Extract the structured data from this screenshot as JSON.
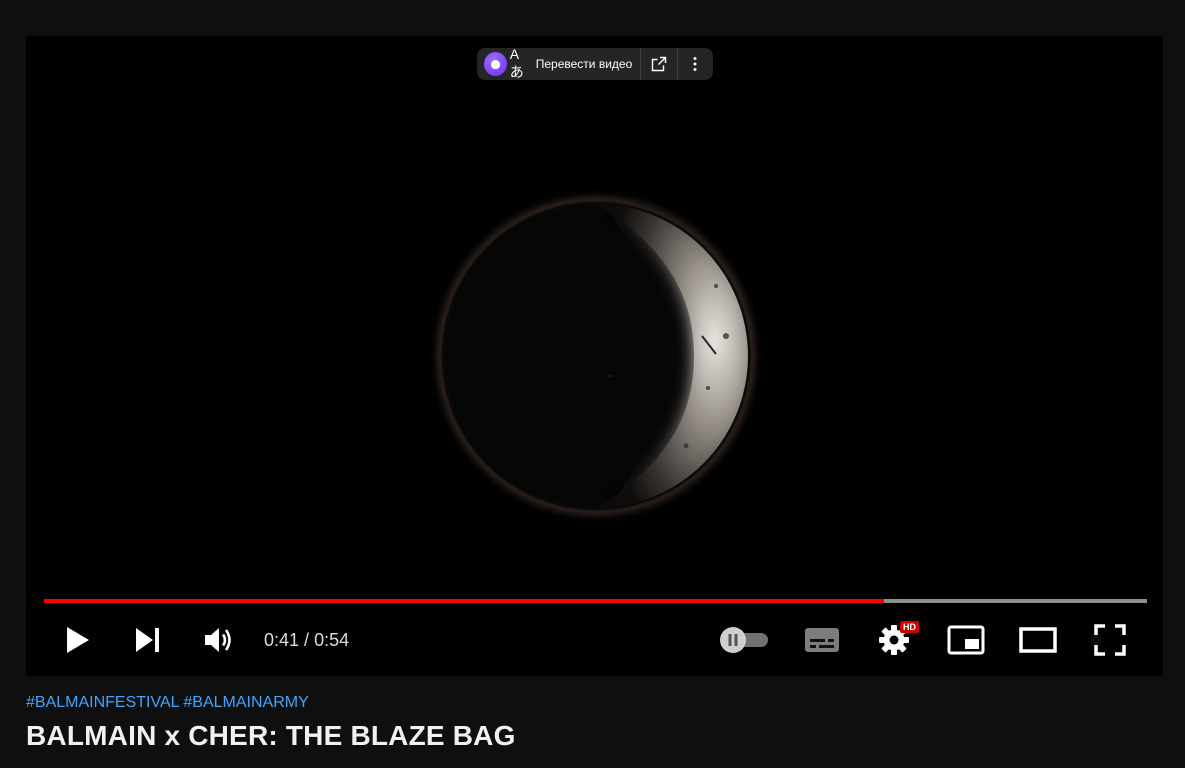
{
  "translate_bar": {
    "glyph": "Aあ",
    "label": "Перевести видео",
    "icons": [
      "alice-icon",
      "external-link-icon",
      "more-vert-icon"
    ]
  },
  "player": {
    "current_time": "0:41",
    "separator": " / ",
    "duration": "0:54",
    "progress_fraction": 0.7615,
    "loaded_fraction": 1.0,
    "settings_badge": "HD",
    "autoplay_on": false,
    "colors": {
      "played": "#ff0000",
      "badge": "#cc0000"
    },
    "icons": [
      "play-icon",
      "next-icon",
      "volume-icon",
      "autoplay-toggle-icon",
      "subtitles-icon",
      "settings-icon",
      "miniplayer-icon",
      "theater-mode-icon",
      "fullscreen-icon"
    ]
  },
  "video": {
    "hashtags": [
      "#BALMAINFESTIVAL",
      "#BALMAINARMY"
    ],
    "title": "BALMAIN x CHER: THE BLAZE BAG",
    "colors": {
      "hashtag": "#3ea6ff",
      "title": "#f1f1f1"
    }
  }
}
